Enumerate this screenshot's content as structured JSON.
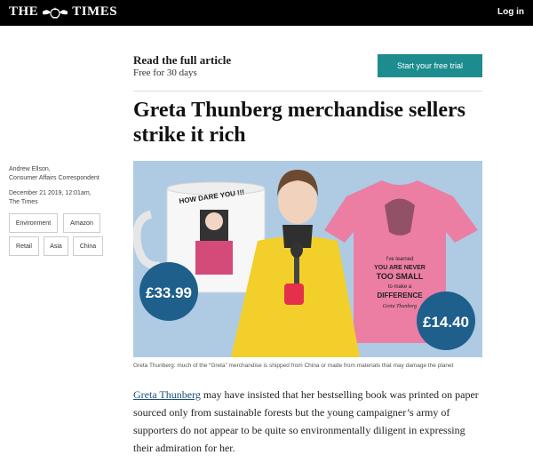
{
  "header": {
    "logo_left": "THE",
    "logo_right": "TIMES",
    "login_label": "Log in"
  },
  "promo": {
    "title": "Read the full article",
    "subtitle": "Free for 30 days",
    "cta_label": "Start your free trial",
    "cta_color": "#1d8c8f"
  },
  "article": {
    "headline": "Greta Thunberg merchandise sellers strike it rich",
    "author_name": "Andrew Ellson,",
    "author_role": "Consumer Affairs Correspondent",
    "date": "December 21 2019, 12:01am,",
    "source": "The Times",
    "tags": [
      "Environment",
      "Amazon",
      "Retail",
      "Asia",
      "China"
    ],
    "image": {
      "mug_text": "HOW DARE YOU !!!",
      "shirt_lines": [
        "I've learned",
        "YOU ARE NEVER",
        "TOO SMALL",
        "to make a",
        "DIFFERENCE",
        "Greta Thunberg"
      ],
      "price_left": "£33.99",
      "price_right": "£14.40"
    },
    "caption": "Greta Thunberg: much of the “Greta” merchandise is shipped from China or made from materials that may damage the planet",
    "body_link": "Greta Thunberg",
    "body_rest": " may have insisted that her bestselling book was printed on paper sourced only from sustainable forests but the young campaigner’s army of supporters do not appear to be quite so environmentally diligent in expressing their admiration for her."
  }
}
